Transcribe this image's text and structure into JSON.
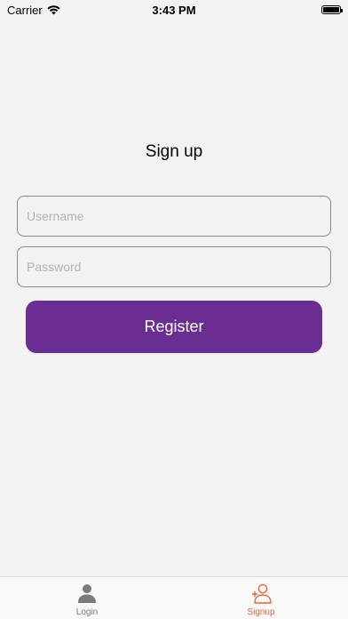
{
  "status_bar": {
    "carrier": "Carrier",
    "time": "3:43 PM"
  },
  "page": {
    "title": "Sign up"
  },
  "form": {
    "username_placeholder": "Username",
    "username_value": "",
    "password_placeholder": "Password",
    "password_value": "",
    "register_label": "Register"
  },
  "tab_bar": {
    "tabs": [
      {
        "label": "Login",
        "icon": "person-icon",
        "active": false
      },
      {
        "label": "Signup",
        "icon": "person-add-icon",
        "active": true
      }
    ],
    "active_color": "#e8643c",
    "inactive_color": "#7a7a7a"
  },
  "colors": {
    "background": "#f2f2f2",
    "button": "#6a2d91"
  }
}
